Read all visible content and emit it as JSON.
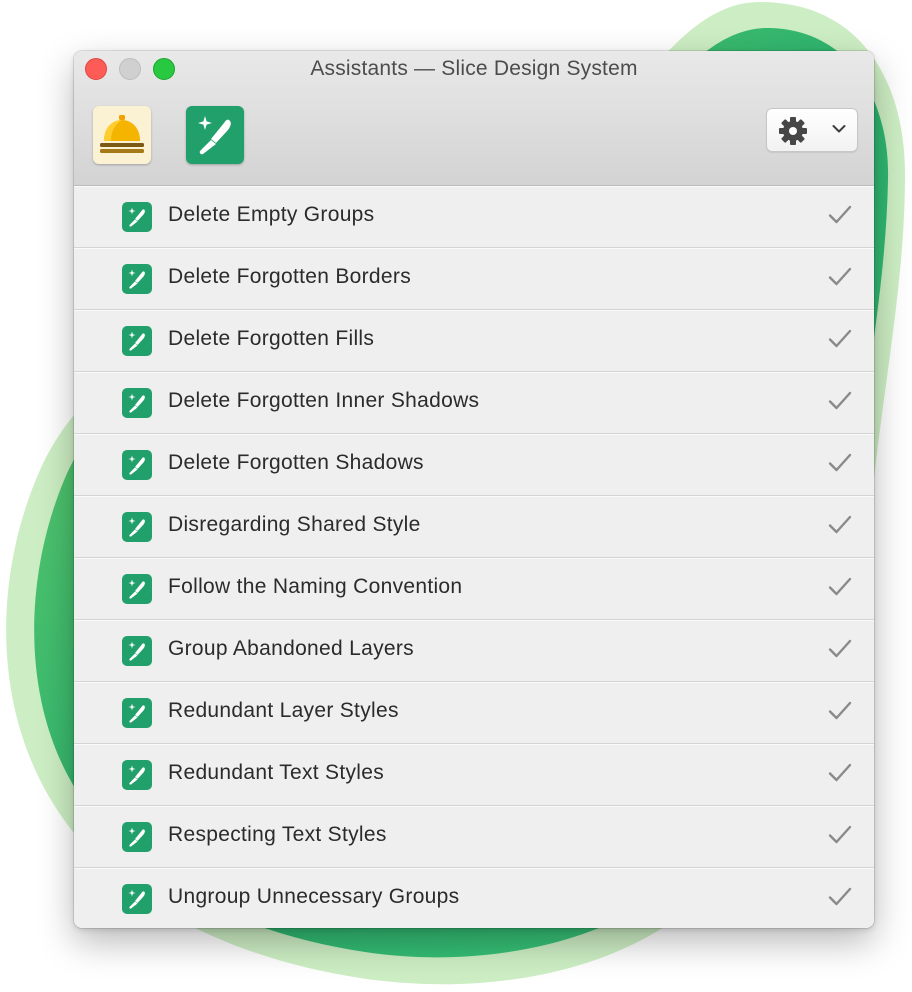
{
  "window": {
    "title": "Assistants — Slice Design System"
  },
  "toolbar": {
    "icons": [
      "bell-icon",
      "knife-sparkle-icon"
    ],
    "settings_menu": {
      "icon": "gear-icon",
      "indicator": "chevron-down-icon"
    }
  },
  "rules": [
    {
      "label": "Delete Empty Groups",
      "icon": "knife-sparkle-icon",
      "status": "check-icon"
    },
    {
      "label": "Delete Forgotten Borders",
      "icon": "knife-sparkle-icon",
      "status": "check-icon"
    },
    {
      "label": "Delete Forgotten Fills",
      "icon": "knife-sparkle-icon",
      "status": "check-icon"
    },
    {
      "label": "Delete Forgotten Inner Shadows",
      "icon": "knife-sparkle-icon",
      "status": "check-icon"
    },
    {
      "label": "Delete Forgotten Shadows",
      "icon": "knife-sparkle-icon",
      "status": "check-icon"
    },
    {
      "label": "Disregarding Shared Style",
      "icon": "knife-sparkle-icon",
      "status": "check-icon"
    },
    {
      "label": "Follow the Naming Convention",
      "icon": "knife-sparkle-icon",
      "status": "check-icon"
    },
    {
      "label": "Group Abandoned Layers",
      "icon": "knife-sparkle-icon",
      "status": "check-icon"
    },
    {
      "label": "Redundant Layer Styles",
      "icon": "knife-sparkle-icon",
      "status": "check-icon"
    },
    {
      "label": "Redundant Text Styles",
      "icon": "knife-sparkle-icon",
      "status": "check-icon"
    },
    {
      "label": "Respecting Text Styles",
      "icon": "knife-sparkle-icon",
      "status": "check-icon"
    },
    {
      "label": "Ungroup Unnecessary Groups",
      "icon": "knife-sparkle-icon",
      "status": "check-icon"
    }
  ],
  "colors": {
    "accent_green": "#22a06b",
    "background_blob_outer": "#c9ecc0",
    "background_blob_inner": "#2bb673",
    "traffic_close": "#fd5b56",
    "traffic_minimize": "#d0d0d0",
    "traffic_maximize": "#28c840",
    "bell_gold": "#f5a800",
    "check_gray": "#8a8a8a"
  }
}
